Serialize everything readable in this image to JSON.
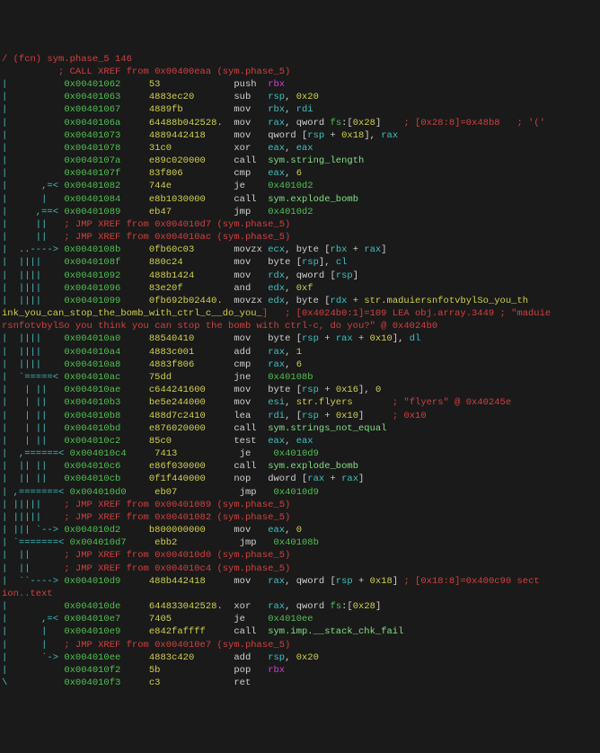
{
  "header": "/ (fcn) sym.phase_5 146",
  "xref_top": "          ; CALL XREF from 0x00400eaa (sym.phase_5)",
  "rows": [
    {
      "flow": "|          ",
      "addr": "0x00401062",
      "bytes": "53            ",
      "op": "push",
      "args": [
        {
          "t": "magenta",
          "v": "rbx"
        }
      ],
      "cmt": ""
    },
    {
      "flow": "|          ",
      "addr": "0x00401063",
      "bytes": "4883ec20      ",
      "op": "sub",
      "args": [
        {
          "t": "cyan",
          "v": "rsp"
        },
        {
          "t": "plain",
          "v": ", "
        },
        {
          "t": "yellow",
          "v": "0x20"
        }
      ],
      "cmt": ""
    },
    {
      "flow": "|          ",
      "addr": "0x00401067",
      "bytes": "4889fb        ",
      "op": "mov",
      "args": [
        {
          "t": "cyan",
          "v": "rbx"
        },
        {
          "t": "plain",
          "v": ", "
        },
        {
          "t": "cyan",
          "v": "rdi"
        }
      ],
      "cmt": ""
    },
    {
      "flow": "|          ",
      "addr": "0x0040106a",
      "bytes": "64488b042528. ",
      "op": "mov",
      "args": [
        {
          "t": "cyan",
          "v": "rax"
        },
        {
          "t": "plain",
          "v": ", qword "
        },
        {
          "t": "green",
          "v": "fs"
        },
        {
          "t": "plain",
          "v": ":["
        },
        {
          "t": "yellow",
          "v": "0x28"
        },
        {
          "t": "plain",
          "v": "]"
        }
      ],
      "cmt": "    ; [0x28:8]=0x48b8   ; '('"
    },
    {
      "flow": "|          ",
      "addr": "0x00401073",
      "bytes": "4889442418    ",
      "op": "mov",
      "args": [
        {
          "t": "plain",
          "v": "qword ["
        },
        {
          "t": "cyan",
          "v": "rsp"
        },
        {
          "t": "plain",
          "v": " + "
        },
        {
          "t": "yellow",
          "v": "0x18"
        },
        {
          "t": "plain",
          "v": "], "
        },
        {
          "t": "cyan",
          "v": "rax"
        }
      ],
      "cmt": ""
    },
    {
      "flow": "|          ",
      "addr": "0x00401078",
      "bytes": "31c0          ",
      "op": "xor",
      "args": [
        {
          "t": "cyan",
          "v": "eax"
        },
        {
          "t": "plain",
          "v": ", "
        },
        {
          "t": "cyan",
          "v": "eax"
        }
      ],
      "cmt": ""
    },
    {
      "flow": "|          ",
      "addr": "0x0040107a",
      "bytes": "e89c020000    ",
      "op": "call",
      "args": [
        {
          "t": "lgreen",
          "v": "sym.string_length"
        }
      ],
      "cmt": ""
    },
    {
      "flow": "|          ",
      "addr": "0x0040107f",
      "bytes": "83f806        ",
      "op": "cmp",
      "args": [
        {
          "t": "cyan",
          "v": "eax"
        },
        {
          "t": "plain",
          "v": ", "
        },
        {
          "t": "yellow",
          "v": "6"
        }
      ],
      "cmt": ""
    },
    {
      "flow": "|      ,=< ",
      "addr": "0x00401082",
      "bytes": "744e          ",
      "op": "je",
      "args": [
        {
          "t": "green",
          "v": "0x4010d2"
        }
      ],
      "cmt": ""
    },
    {
      "flow": "|      |   ",
      "addr": "0x00401084",
      "bytes": "e8b1030000    ",
      "op": "call",
      "args": [
        {
          "t": "lgreen",
          "v": "sym.explode_bomb"
        }
      ],
      "cmt": ""
    },
    {
      "flow": "|     ,==< ",
      "addr": "0x00401089",
      "bytes": "eb47          ",
      "op": "jmp",
      "args": [
        {
          "t": "green",
          "v": "0x4010d2"
        }
      ],
      "cmt": ""
    },
    {
      "flow": "|     ||   ",
      "xref": "; JMP XREF from 0x004010d7 (sym.phase_5)"
    },
    {
      "flow": "|     ||   ",
      "xref": "; JMP XREF from 0x004010ac (sym.phase_5)"
    },
    {
      "flow": "|  ..----> ",
      "addr": "0x0040108b",
      "bytes": "0fb60c03      ",
      "op": "movzx",
      "args": [
        {
          "t": "cyan",
          "v": "ecx"
        },
        {
          "t": "plain",
          "v": ", byte ["
        },
        {
          "t": "cyan",
          "v": "rbx"
        },
        {
          "t": "plain",
          "v": " + "
        },
        {
          "t": "cyan",
          "v": "rax"
        },
        {
          "t": "plain",
          "v": "]"
        }
      ],
      "cmt": ""
    },
    {
      "flow": "|  ||||    ",
      "addr": "0x0040108f",
      "bytes": "880c24        ",
      "op": "mov",
      "args": [
        {
          "t": "plain",
          "v": "byte ["
        },
        {
          "t": "cyan",
          "v": "rsp"
        },
        {
          "t": "plain",
          "v": "], "
        },
        {
          "t": "cyan",
          "v": "cl"
        }
      ],
      "cmt": ""
    },
    {
      "flow": "|  ||||    ",
      "addr": "0x00401092",
      "bytes": "488b1424      ",
      "op": "mov",
      "args": [
        {
          "t": "cyan",
          "v": "rdx"
        },
        {
          "t": "plain",
          "v": ", qword ["
        },
        {
          "t": "cyan",
          "v": "rsp"
        },
        {
          "t": "plain",
          "v": "]"
        }
      ],
      "cmt": ""
    },
    {
      "flow": "|  ||||    ",
      "addr": "0x00401096",
      "bytes": "83e20f        ",
      "op": "and",
      "args": [
        {
          "t": "cyan",
          "v": "edx"
        },
        {
          "t": "plain",
          "v": ", "
        },
        {
          "t": "yellow",
          "v": "0xf"
        }
      ],
      "cmt": ""
    },
    {
      "flow": "|  ||||    ",
      "addr": "0x00401099",
      "bytes": "0fb692b02440. ",
      "op": "movzx",
      "args": [
        {
          "t": "cyan",
          "v": "edx"
        },
        {
          "t": "plain",
          "v": ", byte ["
        },
        {
          "t": "cyan",
          "v": "rdx"
        },
        {
          "t": "plain",
          "v": " + "
        },
        {
          "t": "yellow",
          "v": "str.maduiersnfotvbylSo_you_th"
        }
      ],
      "cmt": ""
    },
    {
      "wrap": "ink_you_can_stop_the_bomb_with_ctrl_c__do_you_",
      "wrap2": "]   ; [0x4024b0:1]=109 LEA obj.array.3449 ; \"maduie"
    },
    {
      "wrap3": "rsnfotvbylSo you think you can stop the bomb with ctrl-c, do you?\" @ 0x4024b0"
    },
    {
      "flow": "|  ||||    ",
      "addr": "0x004010a0",
      "bytes": "88540410      ",
      "op": "mov",
      "args": [
        {
          "t": "plain",
          "v": "byte ["
        },
        {
          "t": "cyan",
          "v": "rsp"
        },
        {
          "t": "plain",
          "v": " + "
        },
        {
          "t": "cyan",
          "v": "rax"
        },
        {
          "t": "plain",
          "v": " + "
        },
        {
          "t": "yellow",
          "v": "0x10"
        },
        {
          "t": "plain",
          "v": "], "
        },
        {
          "t": "cyan",
          "v": "dl"
        }
      ],
      "cmt": ""
    },
    {
      "flow": "|  ||||    ",
      "addr": "0x004010a4",
      "bytes": "4883c001      ",
      "op": "add",
      "args": [
        {
          "t": "cyan",
          "v": "rax"
        },
        {
          "t": "plain",
          "v": ", "
        },
        {
          "t": "yellow",
          "v": "1"
        }
      ],
      "cmt": ""
    },
    {
      "flow": "|  ||||    ",
      "addr": "0x004010a8",
      "bytes": "4883f806      ",
      "op": "cmp",
      "args": [
        {
          "t": "cyan",
          "v": "rax"
        },
        {
          "t": "plain",
          "v": ", "
        },
        {
          "t": "yellow",
          "v": "6"
        }
      ],
      "cmt": ""
    },
    {
      "flow": "|  `=====< ",
      "addr": "0x004010ac",
      "bytes": "75dd          ",
      "op": "jne",
      "args": [
        {
          "t": "green",
          "v": "0x40108b"
        }
      ],
      "cmt": ""
    },
    {
      "flow": "|   | ||   ",
      "addr": "0x004010ae",
      "bytes": "c644241600    ",
      "op": "mov",
      "args": [
        {
          "t": "plain",
          "v": "byte ["
        },
        {
          "t": "cyan",
          "v": "rsp"
        },
        {
          "t": "plain",
          "v": " + "
        },
        {
          "t": "yellow",
          "v": "0x16"
        },
        {
          "t": "plain",
          "v": "], "
        },
        {
          "t": "yellow",
          "v": "0"
        }
      ],
      "cmt": ""
    },
    {
      "flow": "|   | ||   ",
      "addr": "0x004010b3",
      "bytes": "be5e244000    ",
      "op": "mov",
      "args": [
        {
          "t": "cyan",
          "v": "esi"
        },
        {
          "t": "plain",
          "v": ", "
        },
        {
          "t": "yellow",
          "v": "str.flyers"
        }
      ],
      "cmt": "       ; \"flyers\" @ 0x40245e"
    },
    {
      "flow": "|   | ||   ",
      "addr": "0x004010b8",
      "bytes": "488d7c2410    ",
      "op": "lea",
      "args": [
        {
          "t": "cyan",
          "v": "rdi"
        },
        {
          "t": "plain",
          "v": ", ["
        },
        {
          "t": "cyan",
          "v": "rsp"
        },
        {
          "t": "plain",
          "v": " + "
        },
        {
          "t": "yellow",
          "v": "0x10"
        },
        {
          "t": "plain",
          "v": "]"
        }
      ],
      "cmt": "     ; 0x10"
    },
    {
      "flow": "|   | ||   ",
      "addr": "0x004010bd",
      "bytes": "e876020000    ",
      "op": "call",
      "args": [
        {
          "t": "lgreen",
          "v": "sym.strings_not_equal"
        }
      ],
      "cmt": ""
    },
    {
      "flow": "|   | ||   ",
      "addr": "0x004010c2",
      "bytes": "85c0          ",
      "op": "test",
      "args": [
        {
          "t": "cyan",
          "v": "eax"
        },
        {
          "t": "plain",
          "v": ", "
        },
        {
          "t": "cyan",
          "v": "eax"
        }
      ],
      "cmt": ""
    },
    {
      "flow": "|  ,======< ",
      "addr": "0x004010c4",
      "bytes": "7413          ",
      "op": "je",
      "args": [
        {
          "t": "green",
          "v": "0x4010d9"
        }
      ],
      "cmt": ""
    },
    {
      "flow": "|  || ||   ",
      "addr": "0x004010c6",
      "bytes": "e86f030000    ",
      "op": "call",
      "args": [
        {
          "t": "lgreen",
          "v": "sym.explode_bomb"
        }
      ],
      "cmt": ""
    },
    {
      "flow": "|  || ||   ",
      "addr": "0x004010cb",
      "bytes": "0f1f440000    ",
      "op": "nop",
      "args": [
        {
          "t": "plain",
          "v": "dword ["
        },
        {
          "t": "cyan",
          "v": "rax"
        },
        {
          "t": "plain",
          "v": " + "
        },
        {
          "t": "cyan",
          "v": "rax"
        },
        {
          "t": "plain",
          "v": "]"
        }
      ],
      "cmt": ""
    },
    {
      "flow": "| ,=======< ",
      "addr": "0x004010d0",
      "bytes": "eb07          ",
      "op": "jmp",
      "args": [
        {
          "t": "green",
          "v": "0x4010d9"
        }
      ],
      "cmt": ""
    },
    {
      "flow": "| |||||    ",
      "xref": "; JMP XREF from 0x00401089 (sym.phase_5)"
    },
    {
      "flow": "| |||||    ",
      "xref": "; JMP XREF from 0x00401082 (sym.phase_5)"
    },
    {
      "flow": "| ||| `--> ",
      "addr": "0x004010d2",
      "bytes": "b800000000    ",
      "op": "mov",
      "args": [
        {
          "t": "cyan",
          "v": "eax"
        },
        {
          "t": "plain",
          "v": ", "
        },
        {
          "t": "yellow",
          "v": "0"
        }
      ],
      "cmt": ""
    },
    {
      "flow": "| `=======< ",
      "addr": "0x004010d7",
      "bytes": "ebb2          ",
      "op": "jmp",
      "args": [
        {
          "t": "green",
          "v": "0x40108b"
        }
      ],
      "cmt": ""
    },
    {
      "flow": "|  ||      ",
      "xref": "; JMP XREF from 0x004010d0 (sym.phase_5)"
    },
    {
      "flow": "|  ||      ",
      "xref": "; JMP XREF from 0x004010c4 (sym.phase_5)"
    },
    {
      "flow": "|  ``----> ",
      "addr": "0x004010d9",
      "bytes": "488b442418    ",
      "op": "mov",
      "args": [
        {
          "t": "cyan",
          "v": "rax"
        },
        {
          "t": "plain",
          "v": ", qword ["
        },
        {
          "t": "cyan",
          "v": "rsp"
        },
        {
          "t": "plain",
          "v": " + "
        },
        {
          "t": "yellow",
          "v": "0x18"
        },
        {
          "t": "plain",
          "v": "]"
        }
      ],
      "cmt": " ; [0x18:8]=0x400c90 sect"
    },
    {
      "wrap4": "ion..text"
    },
    {
      "flow": "|          ",
      "addr": "0x004010de",
      "bytes": "644833042528. ",
      "op": "xor",
      "args": [
        {
          "t": "cyan",
          "v": "rax"
        },
        {
          "t": "plain",
          "v": ", qword "
        },
        {
          "t": "green",
          "v": "fs"
        },
        {
          "t": "plain",
          "v": ":["
        },
        {
          "t": "yellow",
          "v": "0x28"
        },
        {
          "t": "plain",
          "v": "]"
        }
      ],
      "cmt": ""
    },
    {
      "flow": "|      ,=< ",
      "addr": "0x004010e7",
      "bytes": "7405          ",
      "op": "je",
      "args": [
        {
          "t": "green",
          "v": "0x4010ee"
        }
      ],
      "cmt": ""
    },
    {
      "flow": "|      |   ",
      "addr": "0x004010e9",
      "bytes": "e842faffff    ",
      "op": "call",
      "args": [
        {
          "t": "lgreen",
          "v": "sym.imp.__stack_chk_fail"
        }
      ],
      "cmt": ""
    },
    {
      "flow": "|      |   ",
      "xref": "; JMP XREF from 0x004010e7 (sym.phase_5)"
    },
    {
      "flow": "|      `-> ",
      "addr": "0x004010ee",
      "bytes": "4883c420      ",
      "op": "add",
      "args": [
        {
          "t": "cyan",
          "v": "rsp"
        },
        {
          "t": "plain",
          "v": ", "
        },
        {
          "t": "yellow",
          "v": "0x20"
        }
      ],
      "cmt": ""
    },
    {
      "flow": "|          ",
      "addr": "0x004010f2",
      "bytes": "5b            ",
      "op": "pop",
      "args": [
        {
          "t": "magenta",
          "v": "rbx"
        }
      ],
      "cmt": ""
    },
    {
      "flow": "\\          ",
      "addr": "0x004010f3",
      "bytes": "c3            ",
      "op": "ret",
      "args": [],
      "cmt": ""
    }
  ]
}
